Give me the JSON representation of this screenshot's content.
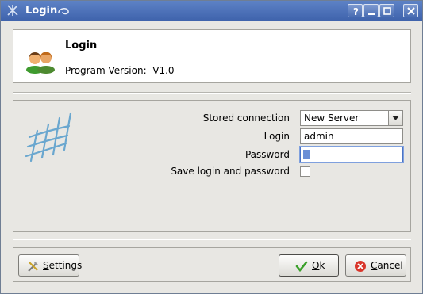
{
  "window": {
    "title": "Login"
  },
  "header": {
    "title": "Login",
    "version_label": "Program Version:",
    "version_value": "V1.0"
  },
  "form": {
    "stored_connection_label": "Stored connection",
    "stored_connection_value": "New Server",
    "login_label": "Login",
    "login_value": "admin",
    "password_label": "Password",
    "save_label": "Save login and password",
    "save_checked": false
  },
  "buttons": {
    "settings_first": "S",
    "settings_rest": "ettings",
    "ok_first": "O",
    "ok_rest": "k",
    "cancel_first": "C",
    "cancel_rest": "ancel"
  },
  "colors": {
    "titlebar": "#4a6db3",
    "focus": "#4a73c4"
  }
}
